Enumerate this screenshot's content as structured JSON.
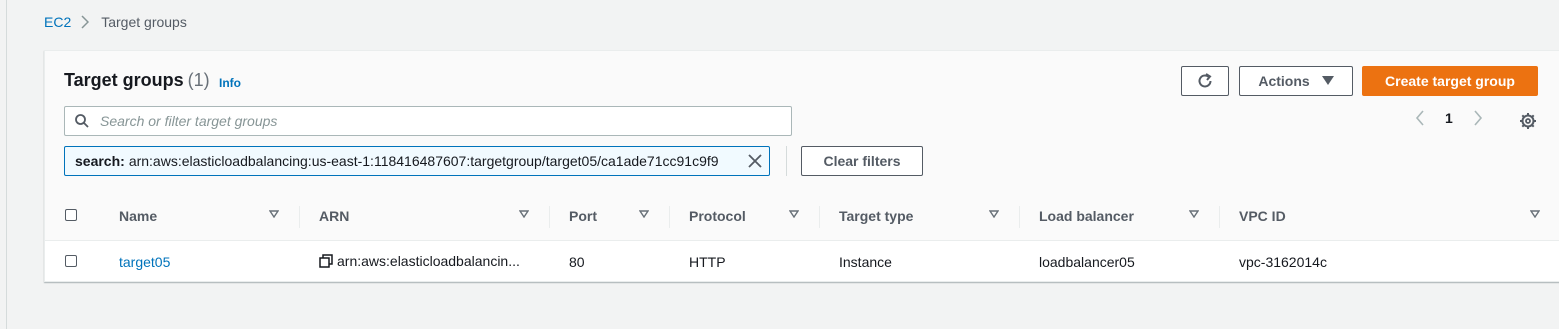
{
  "breadcrumb": {
    "root": "EC2",
    "current": "Target groups"
  },
  "panel": {
    "title": "Target groups",
    "count": "(1)",
    "info_label": "Info"
  },
  "toolbar": {
    "refresh_icon": "refresh-icon",
    "actions_label": "Actions",
    "create_label": "Create target group"
  },
  "search": {
    "placeholder": "Search or filter target groups",
    "value": ""
  },
  "filter_token": {
    "key": "search:",
    "value": "arn:aws:elasticloadbalancing:us-east-1:118416487607:targetgroup/target05/ca1ade71cc91c9f9"
  },
  "clear_filters_label": "Clear filters",
  "pagination": {
    "page": "1"
  },
  "table": {
    "columns": [
      "Name",
      "ARN",
      "Port",
      "Protocol",
      "Target type",
      "Load balancer",
      "VPC ID"
    ],
    "rows": [
      {
        "name": "target05",
        "arn": "arn:aws:elasticloadbalancin...",
        "port": "80",
        "protocol": "HTTP",
        "target_type": "Instance",
        "load_balancer": "loadbalancer05",
        "vpc_id": "vpc-3162014c"
      }
    ]
  },
  "colors": {
    "accent": "#0073bb",
    "primary_button": "#ec7211",
    "background": "#f2f3f3"
  }
}
